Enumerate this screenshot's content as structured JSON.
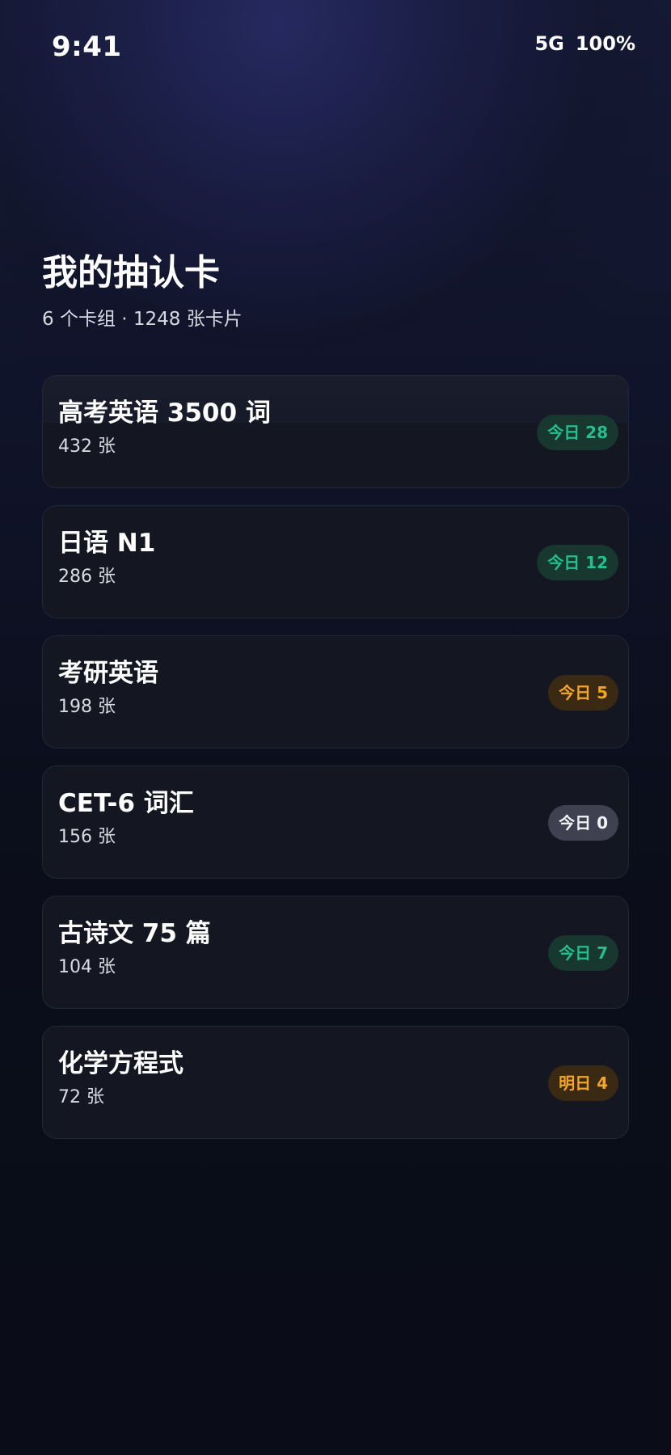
{
  "status_bar": {
    "time": "9:41",
    "network": "5G",
    "battery": "100%"
  },
  "header": {
    "title": "我的抽认卡",
    "subtitle": "6 个卡组 · 1248 张卡片"
  },
  "decks": [
    {
      "name": "高考英语 3500 词",
      "count": "432 张",
      "badge": "今日 28",
      "badge_status": "green"
    },
    {
      "name": "日语 N1",
      "count": "286 张",
      "badge": "今日 12",
      "badge_status": "green"
    },
    {
      "name": "考研英语",
      "count": "198 张",
      "badge": "今日 5",
      "badge_status": "amber"
    },
    {
      "name": "CET-6 词汇",
      "count": "156 张",
      "badge": "今日 0",
      "badge_status": "gray"
    },
    {
      "name": "古诗文 75 篇",
      "count": "104 张",
      "badge": "今日 7",
      "badge_status": "green"
    },
    {
      "name": "化学方程式",
      "count": "72 张",
      "badge": "明日 4",
      "badge_status": "amber"
    }
  ],
  "colors": {
    "background": "#0a0d17",
    "card": "#141722",
    "green_text": "#22c08b",
    "green_bg": "#17372f",
    "amber_text": "#f5a623",
    "amber_bg": "#3a2a13",
    "gray_text": "#f2f3f7",
    "gray_bg": "#3f4150"
  }
}
